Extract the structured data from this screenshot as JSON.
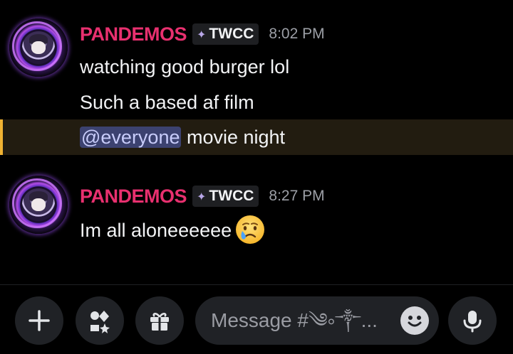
{
  "messages": [
    {
      "username": "PANDEMOS",
      "tag_icon": "sparkle-icon",
      "tag": "TWCC",
      "time": "8:02 PM",
      "lines": [
        "watching good burger lol",
        "Such a based af film"
      ],
      "mention_line": {
        "mention": "@everyone",
        "text": " movie night"
      }
    },
    {
      "username": "PANDEMOS",
      "tag_icon": "sparkle-icon",
      "tag": "TWCC",
      "time": "8:27 PM",
      "lines": [
        "Im all aloneeeeee"
      ],
      "emoji": "crying-face-emoji"
    }
  ],
  "composer": {
    "placeholder": "Message #༄༚༒...",
    "buttons": [
      "plus-icon",
      "apps-icon",
      "gift-icon"
    ],
    "emoji_icon": "smiley-icon",
    "voice_icon": "microphone-icon"
  },
  "colors": {
    "background": "#000000",
    "username": "#e8306f",
    "mention_bg": "#3c4270",
    "mention_text": "#c9cdfb",
    "highlight_bar": "#f0b232",
    "highlight_bg": "#221c10",
    "timestamp": "#9c9fa6",
    "control_bg": "#202226"
  }
}
